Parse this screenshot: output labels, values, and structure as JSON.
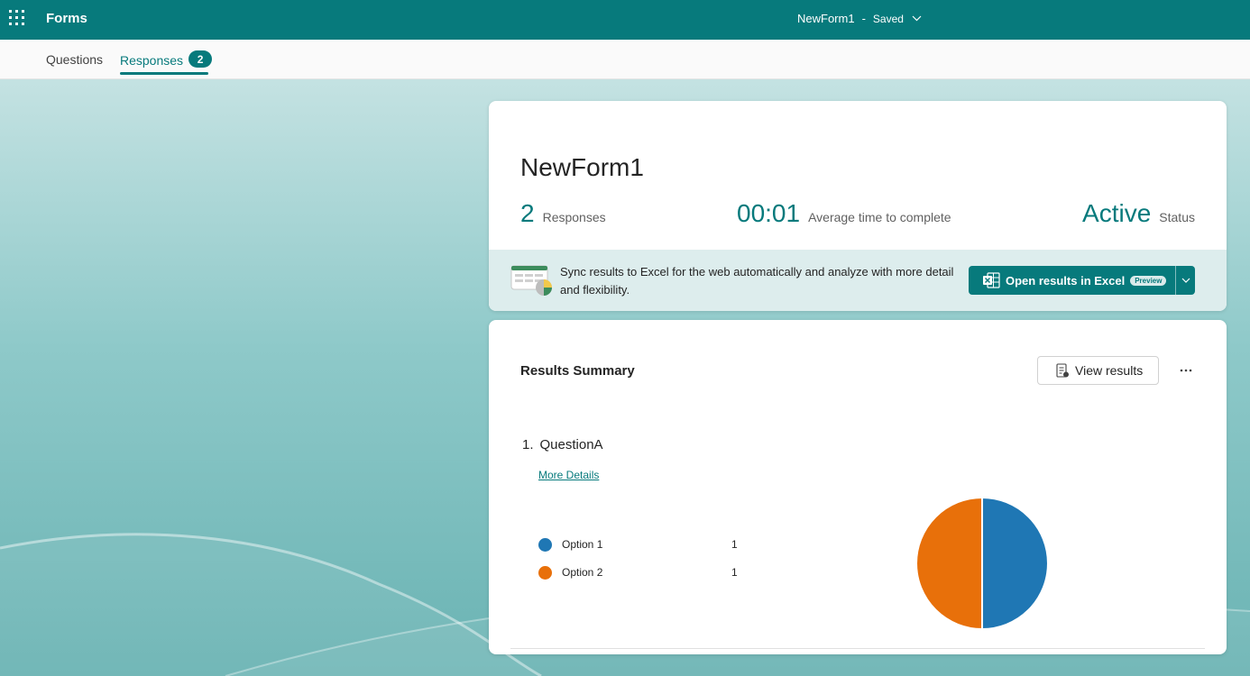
{
  "topbar": {
    "app_title": "Forms",
    "doc_title": "NewForm1",
    "separator": "-",
    "save_status": "Saved"
  },
  "tabs": [
    {
      "label": "Questions",
      "active": false
    },
    {
      "label": "Responses",
      "active": true,
      "badge": "2"
    }
  ],
  "summary": {
    "form_title": "NewForm1",
    "responses_count": "2",
    "responses_label": "Responses",
    "avg_time": "00:01",
    "avg_time_label": "Average time to complete",
    "status": "Active",
    "status_label": "Status"
  },
  "excel_banner": {
    "text": "Sync results to Excel for the web automatically and analyze with more detail and flexibility.",
    "button_label": "Open results in Excel",
    "preview_badge": "Preview"
  },
  "results": {
    "title": "Results Summary",
    "view_results_label": "View results",
    "questions": [
      {
        "number": "1.",
        "title": "QuestionA",
        "more_details_label": "More Details",
        "options": [
          {
            "label": "Option 1",
            "count": "1",
            "color": "#1f77b4"
          },
          {
            "label": "Option 2",
            "count": "1",
            "color": "#e8700a"
          }
        ]
      }
    ]
  },
  "colors": {
    "brand": "#077a7c",
    "option_1": "#1f77b4",
    "option_2": "#e8700a"
  },
  "chart_data": {
    "type": "pie",
    "categories": [
      "Option 1",
      "Option 2"
    ],
    "values": [
      1,
      1
    ],
    "colors": [
      "#1f77b4",
      "#e8700a"
    ]
  }
}
